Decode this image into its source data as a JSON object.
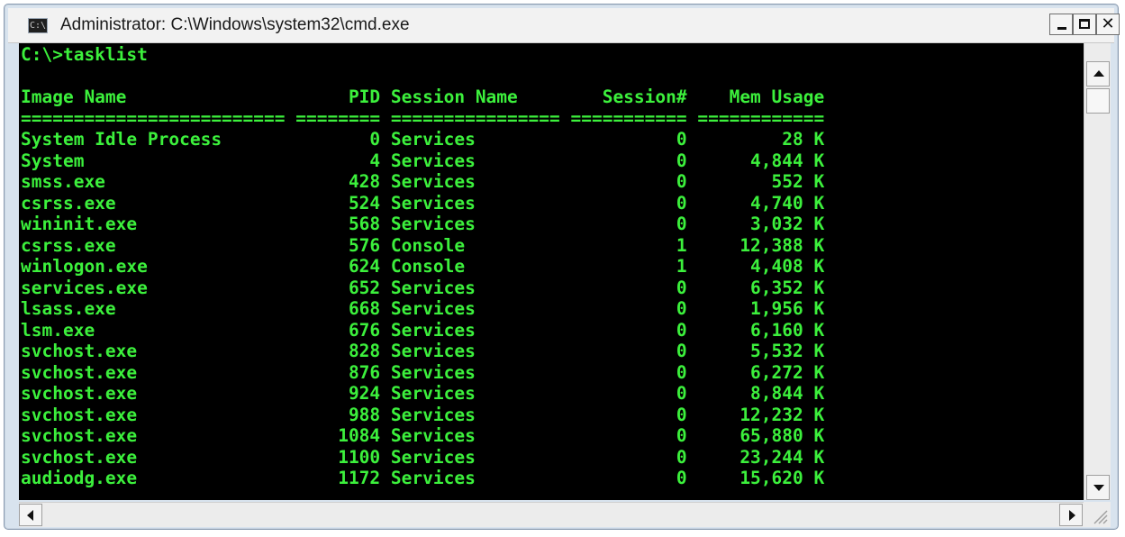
{
  "window": {
    "title": "Administrator: C:\\Windows\\system32\\cmd.exe",
    "icon_label": "C:\\",
    "controls": {
      "minimize": "minimize-icon",
      "maximize": "maximize-icon",
      "close_glyph": "✕"
    }
  },
  "console": {
    "colors": {
      "background": "#000000",
      "text": "#3cf03c"
    },
    "lines": [
      "C:\\>tasklist",
      "",
      "Image Name                     PID Session Name        Session#    Mem Usage",
      "========================= ======== ================ =========== ============",
      "System Idle Process              0 Services                   0         28 K",
      "System                           4 Services                   0      4,844 K",
      "smss.exe                       428 Services                   0        552 K",
      "csrss.exe                      524 Services                   0      4,740 K",
      "wininit.exe                    568 Services                   0      3,032 K",
      "csrss.exe                      576 Console                    1     12,388 K",
      "winlogon.exe                   624 Console                    1      4,408 K",
      "services.exe                   652 Services                   0      6,352 K",
      "lsass.exe                      668 Services                   0      1,956 K",
      "lsm.exe                        676 Services                   0      6,160 K",
      "svchost.exe                    828 Services                   0      5,532 K",
      "svchost.exe                    876 Services                   0      6,272 K",
      "svchost.exe                    924 Services                   0      8,844 K",
      "svchost.exe                    988 Services                   0     12,232 K",
      "svchost.exe                   1084 Services                   0     65,880 K",
      "svchost.exe                   1100 Services                   0     23,244 K",
      "audiodg.exe                   1172 Services                   0     15,620 K"
    ]
  },
  "scrollbars": {
    "vertical": {
      "up_icon": "arrow-up-icon",
      "down_icon": "arrow-down-icon"
    },
    "horizontal": {
      "left_icon": "arrow-left-icon",
      "right_icon": "arrow-right-icon"
    }
  }
}
